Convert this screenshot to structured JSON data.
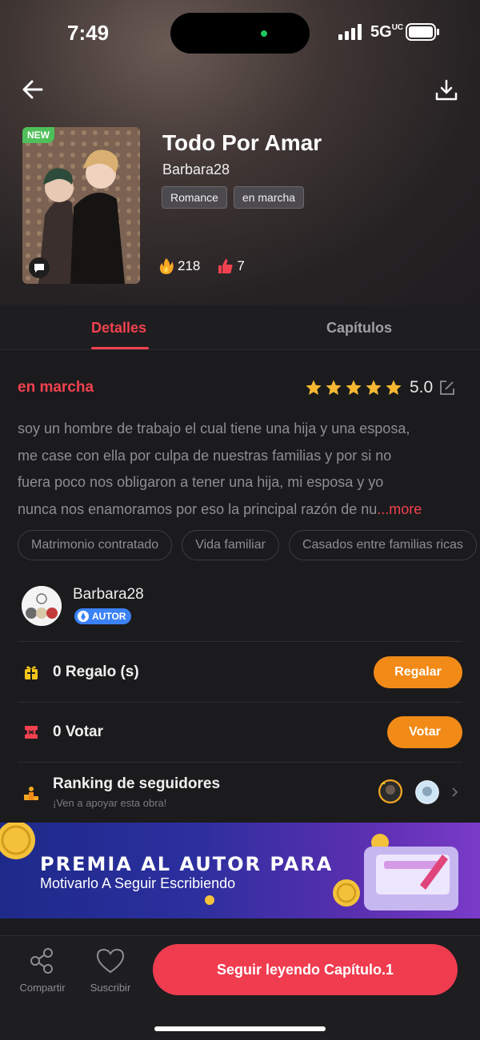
{
  "status_bar": {
    "time": "7:49",
    "network": "5G",
    "network_suffix": "UC"
  },
  "header": {
    "back_icon": "arrow-left-icon",
    "download_icon": "download-icon"
  },
  "book": {
    "new_badge": "NEW",
    "title": "Todo Por Amar",
    "author": "Barbara28",
    "tags": [
      "Romance",
      "en marcha"
    ],
    "fire_count": "218",
    "like_count": "7"
  },
  "tabs": {
    "details": "Detalles",
    "chapters": "Capítulos"
  },
  "details": {
    "status": "en marcha",
    "rating": "5.0",
    "stars": 5,
    "description_lines": [
      "soy un hombre de trabajo el cual tiene una hija y una esposa,",
      "me case con ella por culpa de nuestras familias y por si no",
      "fuera poco nos obligaron a tener una hija, mi esposa y yo",
      "nunca nos enamoramos por eso la principal razón de nu"
    ],
    "more_label": "...more",
    "genre_tags": [
      "Matrimonio contratado",
      "Vida familiar",
      "Casados entre familias ricas"
    ]
  },
  "author_card": {
    "name": "Barbara28",
    "badge": "AUTOR"
  },
  "gift": {
    "label": "0 Regalo (s)",
    "button": "Regalar"
  },
  "vote": {
    "label": "0 Votar",
    "button": "Votar"
  },
  "ranking": {
    "title": "Ranking de seguidores",
    "subtitle": "¡Ven a apoyar esta obra!"
  },
  "banner": {
    "title": "PREMIA AL AUTOR PARA",
    "subtitle": "Motivarlo A Seguir Escribiendo"
  },
  "bottom_bar": {
    "share": "Compartir",
    "subscribe": "Suscribir",
    "read_button": "Seguir leyendo Capítulo.1"
  },
  "colors": {
    "accent": "#f2414f",
    "orange": "#f28a17",
    "background": "#1b1b1d"
  }
}
